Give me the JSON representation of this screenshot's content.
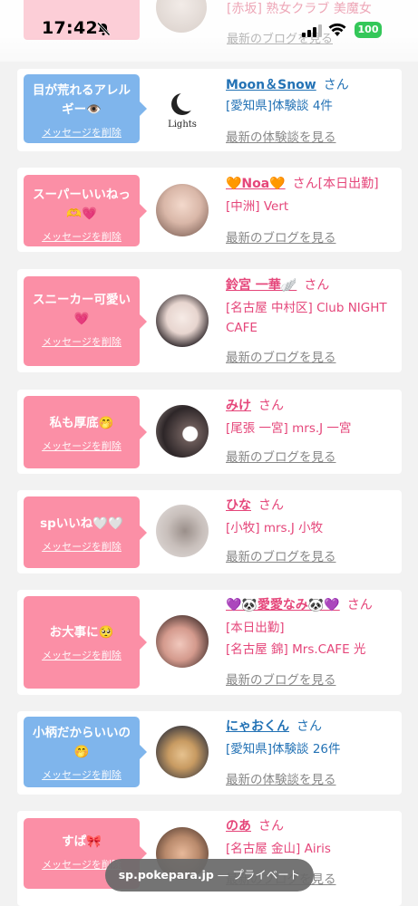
{
  "status_bar": {
    "time": "17:42",
    "battery": "100"
  },
  "top_peek": {
    "detail": "[赤坂] 熟女クラブ 美魔女",
    "link": "最新のブログを見る"
  },
  "cards": [
    {
      "type": "blue",
      "message": "目が荒れるアレルギー👁️",
      "delete_label": "メッセージを削除",
      "avatar": "lights-logo",
      "name": "Moon＆Snow",
      "san": "さん",
      "details": [
        "[愛知県]体験談 4件"
      ],
      "link": "最新の体験談を見る"
    },
    {
      "type": "pink",
      "message": "スーパーいいねっ🫶💗",
      "delete_label": "メッセージを削除",
      "avatar": "girl-photo",
      "name": "🧡Noa🧡",
      "san": "さん[本日出勤]",
      "details": [
        "[中洲] Vert"
      ],
      "link": "最新のブログを見る"
    },
    {
      "type": "pink",
      "message": "スニーカー可愛い💗",
      "delete_label": "メッセージを削除",
      "avatar": "girl-photo",
      "name": "鈴宮 一華🪽",
      "san": "さん",
      "details": [
        "[名古屋 中村区] Club NIGHT CAFE"
      ],
      "link": "最新のブログを見る"
    },
    {
      "type": "pink",
      "message": "私も厚底🤭",
      "delete_label": "メッセージを削除",
      "avatar": "girl-photo",
      "name": "みけ",
      "san": "さん",
      "details": [
        "[尾張 一宮] mrs.J 一宮"
      ],
      "link": "最新のブログを見る"
    },
    {
      "type": "pink",
      "message": "spいいね🤍🤍",
      "delete_label": "メッセージを削除",
      "avatar": "girl-photo",
      "name": "ひな",
      "san": "さん",
      "details": [
        "[小牧] mrs.J 小牧"
      ],
      "link": "最新のブログを見る"
    },
    {
      "type": "pink",
      "message": "お大事に🥺",
      "delete_label": "メッセージを削除",
      "avatar": "girl-photo",
      "name": "💜🐼愛愛なみ🐼💜",
      "san": "さん",
      "details": [
        "[本日出勤]",
        "[名古屋 錦] Mrs.CAFE 光"
      ],
      "link": "最新のブログを見る"
    },
    {
      "type": "blue",
      "message": "小柄だからいいの🤭",
      "delete_label": "メッセージを削除",
      "avatar": "cat-photo",
      "name": "にゃおくん",
      "san": "さん",
      "details": [
        "[愛知県]体験談 26件"
      ],
      "link": "最新の体験談を見る"
    },
    {
      "type": "pink",
      "message": "すぱ🎀",
      "delete_label": "メッセージを削除",
      "avatar": "girl-photo",
      "name": "のあ",
      "san": "さん",
      "details": [
        "[名古屋 金山] Airis"
      ],
      "link": "最新のブログを見る"
    }
  ],
  "url_bar": {
    "host": "sp.pokepara.jp",
    "mode": " — プライベート"
  },
  "colors": {
    "pink_accent": "#e5467a",
    "blue_accent": "#2372b5",
    "pink_bubble": "#fb8fa6",
    "blue_bubble": "#7fb5ec",
    "battery": "#34c759"
  }
}
